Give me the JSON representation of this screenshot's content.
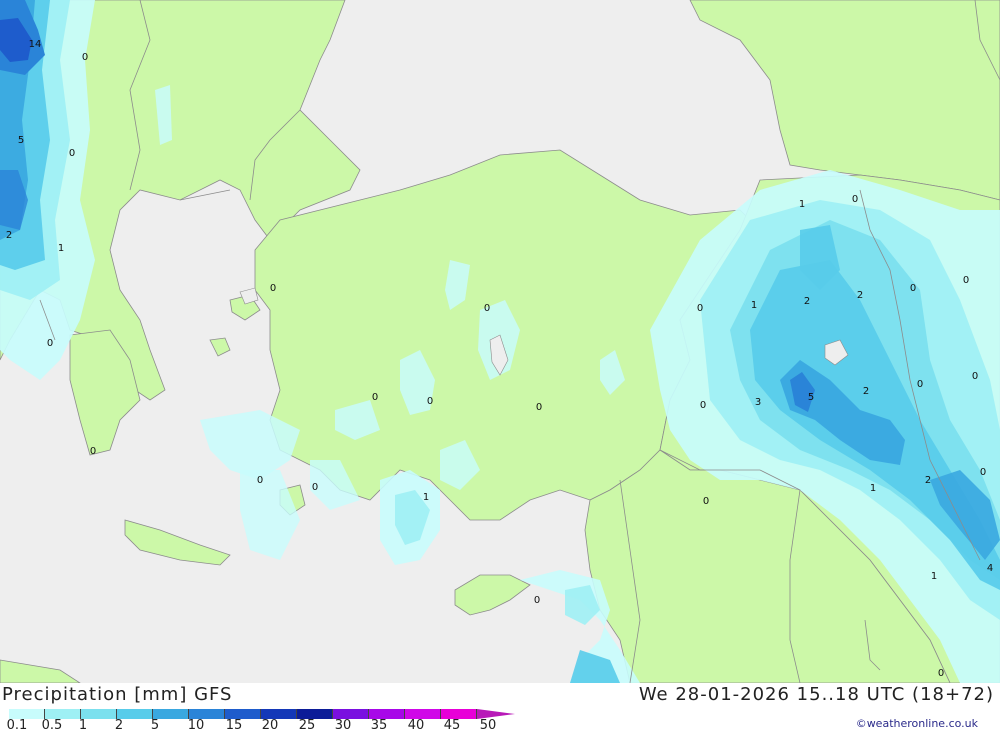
{
  "title": "Precipitation [mm] GFS",
  "datetime": "We 28-01-2026 15..18 UTC (18+72)",
  "credit": "©weatheronline.co.uk",
  "legend": {
    "labels": [
      "0.1",
      "0.5",
      "1",
      "2",
      "5",
      "10",
      "15",
      "20",
      "25",
      "30",
      "35",
      "40",
      "45",
      "50"
    ],
    "colors": [
      "#c8fcfc",
      "#9ef0f4",
      "#7be0ee",
      "#58ccea",
      "#3aa8e0",
      "#2a84d8",
      "#1e5ccc",
      "#1438b8",
      "#0c1c98",
      "#7a10e0",
      "#a808e8",
      "#d008e8",
      "#e800d8",
      "#b81ab8"
    ]
  },
  "map_colors": {
    "sea": "#eeeeee",
    "land": "#ccf8a8",
    "border": "#8c8c8c"
  },
  "map_labels": [
    "14",
    "0",
    "5",
    "0",
    "2",
    "1",
    "0",
    "0",
    "0",
    "0",
    "0",
    "0",
    "0",
    "0",
    "0",
    "1",
    "1",
    "0",
    "0",
    "1",
    "2",
    "2",
    "0",
    "0",
    "3",
    "5",
    "2",
    "0",
    "0",
    "0",
    "0",
    "1",
    "2",
    "0",
    "1",
    "4",
    "0",
    "0"
  ]
}
